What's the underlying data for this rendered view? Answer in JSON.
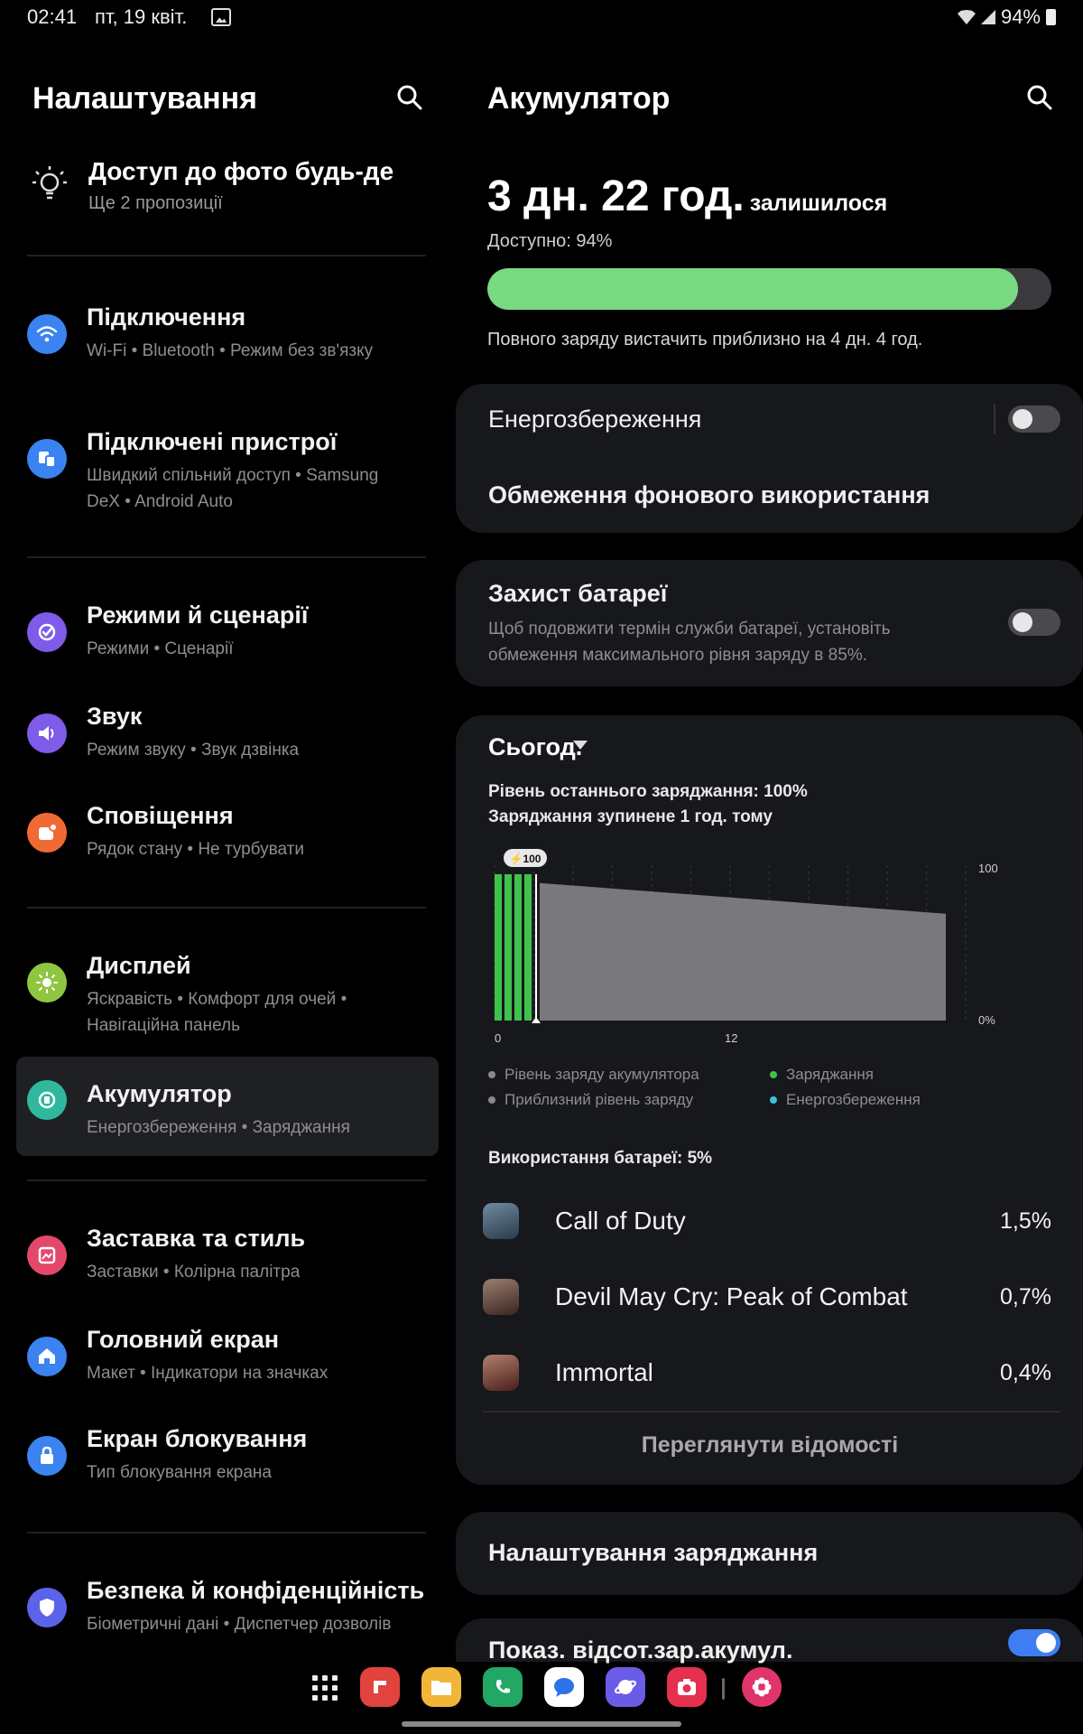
{
  "status_bar": {
    "time": "02:41",
    "date": "пт, 19 квіт.",
    "battery": "94%"
  },
  "settings": {
    "title": "Налаштування",
    "tip": {
      "title": "Доступ до фото будь-де",
      "subtitle": "Ще 2 пропозиції"
    },
    "items": [
      {
        "title": "Підключення",
        "subtitle": "Wi-Fi • Bluetooth • Режим без зв'язку",
        "icon": "wifi-icon",
        "color": "#3a83f0"
      },
      {
        "title": "Підключені пристрої",
        "subtitle": "Швидкий спільний доступ • Samsung DeX • Android Auto",
        "icon": "devices-icon",
        "color": "#3a83f0"
      },
      {
        "title": "Режими й сценарії",
        "subtitle": "Режими • Сценарії",
        "icon": "modes-icon",
        "color": "#7e5be8"
      },
      {
        "title": "Звук",
        "subtitle": "Режим звуку • Звук дзвінка",
        "icon": "sound-icon",
        "color": "#7e5be8"
      },
      {
        "title": "Сповіщення",
        "subtitle": "Рядок стану • Не турбувати",
        "icon": "notifications-icon",
        "color": "#f06a35"
      },
      {
        "title": "Дисплей",
        "subtitle": "Яскравість • Комфорт для очей • Навігаційна панель",
        "icon": "display-icon",
        "color": "#8ec63f"
      },
      {
        "title": "Акумулятор",
        "subtitle": "Енергозбереження • Заряджання",
        "icon": "battery-icon",
        "color": "#2fb89e"
      },
      {
        "title": "Заставка та стиль",
        "subtitle": "Заставки • Колірна палітра",
        "icon": "wallpaper-icon",
        "color": "#e3486a"
      },
      {
        "title": "Головний екран",
        "subtitle": "Макет • Індикатори на значках",
        "icon": "home-icon",
        "color": "#3a83f0"
      },
      {
        "title": "Екран блокування",
        "subtitle": "Тип блокування екрана",
        "icon": "lock-icon",
        "color": "#3a83f0"
      },
      {
        "title": "Безпека й конфіденційність",
        "subtitle": "Біометричні дані • Диспетчер дозволів",
        "icon": "shield-icon",
        "color": "#5b63e8"
      }
    ]
  },
  "battery": {
    "title": "Акумулятор",
    "remaining_time": "3 дн. 22 год.",
    "remaining_suffix": "залишилося",
    "available": "Доступно: 94%",
    "level_fraction": 0.94,
    "full_charge_note": "Повного заряду вистачить приблизно на 4 дн. 4 год.",
    "power_saving": {
      "label": "Енергозбереження",
      "enabled": false
    },
    "background_limits": "Обмеження фонового використання",
    "protection": {
      "label": "Захист батареї",
      "description": "Щоб подовжити термін служби батареї, установіть обмеження максимального рівня заряду в 85%.",
      "enabled": false
    },
    "period": "Сьогод.",
    "last_charge": "Рівень останнього заряджання: 100%",
    "charge_stopped": "Заряджання зупинене 1 год. тому",
    "legend": {
      "level": "Рівень заряду акумулятора",
      "estimated": "Приблизний рівень заряду",
      "charging": "Заряджання",
      "saving": "Енергозбереження"
    },
    "usage_title": "Використання батареї: 5%",
    "apps": [
      {
        "name": "Call of Duty",
        "percent": "1,5%"
      },
      {
        "name": "Devil May Cry: Peak of Combat",
        "percent": "0,7%"
      },
      {
        "name": "Immortal",
        "percent": "0,4%"
      }
    ],
    "details_button": "Переглянути відомості",
    "charging_settings": "Налаштування заряджання",
    "show_percentage": {
      "label": "Показ. відсот.зар.акумул.",
      "enabled": true
    }
  },
  "chart_data": {
    "type": "bar",
    "title": "",
    "x_ticks": [
      "0",
      "12"
    ],
    "y_ticks": [
      "100",
      "0%"
    ],
    "peak_label": "100",
    "ylim": [
      0,
      100
    ],
    "series": [
      {
        "name": "Рівень заряду акумулятора",
        "color": "#8a8a8e"
      },
      {
        "name": "Приблизний рівень заряду",
        "color": "#8a8a8e"
      },
      {
        "name": "Заряджання",
        "color": "#3fc24c"
      },
      {
        "name": "Енергозбереження",
        "color": "#3ac3d8"
      }
    ],
    "charging_bars": [
      100,
      100,
      100,
      100
    ],
    "discharge_start_value": 94,
    "discharge_end_value": 73
  },
  "colors": {
    "accent": "#3e7ef2",
    "battery_fill": "#79d983",
    "charging": "#3fc24c"
  }
}
